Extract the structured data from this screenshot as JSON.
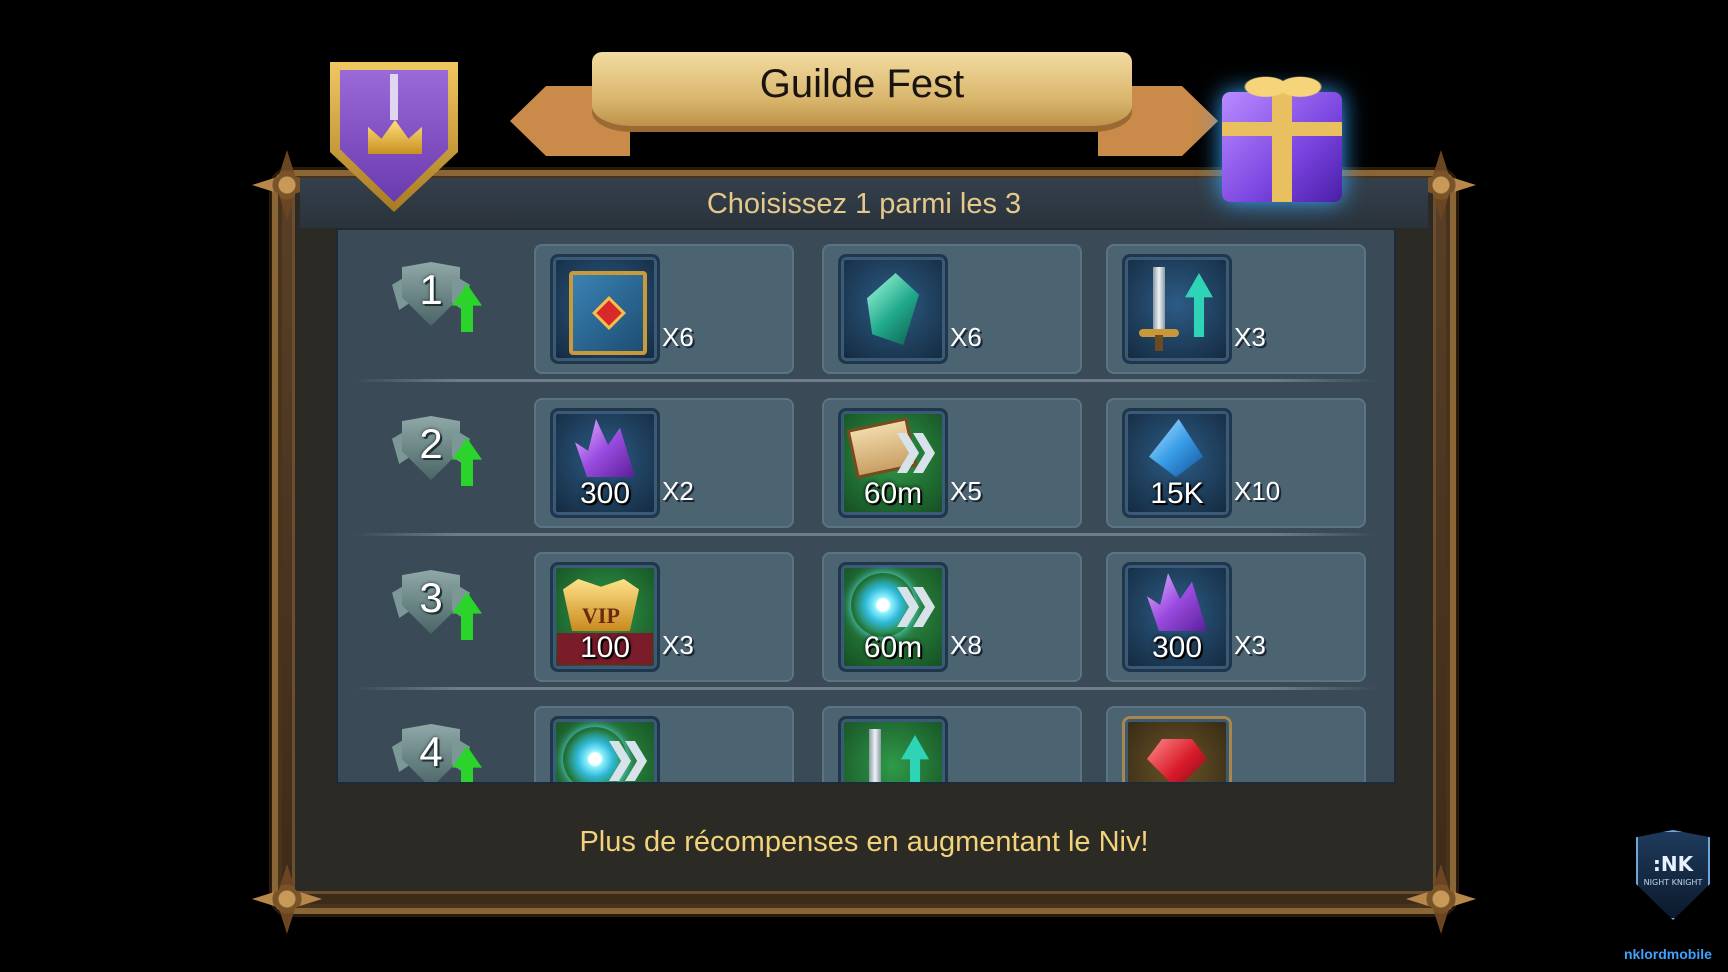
{
  "header": {
    "title": "Guilde Fest",
    "subtitle": "Choisissez 1 parmi les 3"
  },
  "rows": [
    {
      "level": "1",
      "rewards": [
        {
          "icon": "book-icon",
          "label": "",
          "multiplier": "X6"
        },
        {
          "icon": "green-shard-icon",
          "label": "",
          "multiplier": "X6"
        },
        {
          "icon": "sword-upgrade-icon",
          "label": "",
          "multiplier": "X3"
        }
      ]
    },
    {
      "level": "2",
      "rewards": [
        {
          "icon": "purple-crystal-icon",
          "label": "300",
          "multiplier": "X2"
        },
        {
          "icon": "research-speedup-icon",
          "label": "60m",
          "multiplier": "X5"
        },
        {
          "icon": "blue-crystal-icon",
          "label": "15K",
          "multiplier": "X10"
        }
      ]
    },
    {
      "level": "3",
      "rewards": [
        {
          "icon": "vip-icon",
          "label": "100",
          "multiplier": "X3"
        },
        {
          "icon": "speedup-icon",
          "label": "60m",
          "multiplier": "X8"
        },
        {
          "icon": "purple-crystal-icon",
          "label": "300",
          "multiplier": "X3"
        }
      ]
    },
    {
      "level": "4",
      "rewards": [
        {
          "icon": "speedup-icon",
          "label": "",
          "multiplier": ""
        },
        {
          "icon": "sword-upgrade-icon",
          "label": "",
          "multiplier": ""
        },
        {
          "icon": "ruby-icon",
          "label": "",
          "multiplier": ""
        }
      ]
    }
  ],
  "footer": {
    "text": "Plus de récompenses en augmentant le Niv!"
  },
  "watermark": {
    "logo_text": ":NK",
    "logo_sub": "NIGHT KNIGHT",
    "caption": "nklordmobile"
  },
  "colors": {
    "title_ribbon": "#d9b56c",
    "subtitle_text": "#e6c98a",
    "footer_text": "#f2d27a",
    "panel_bg": "#3a4a57",
    "reward_card": "#4c6372",
    "level_arrow": "#2bd42b",
    "watermark_text": "#3fa2ff"
  }
}
